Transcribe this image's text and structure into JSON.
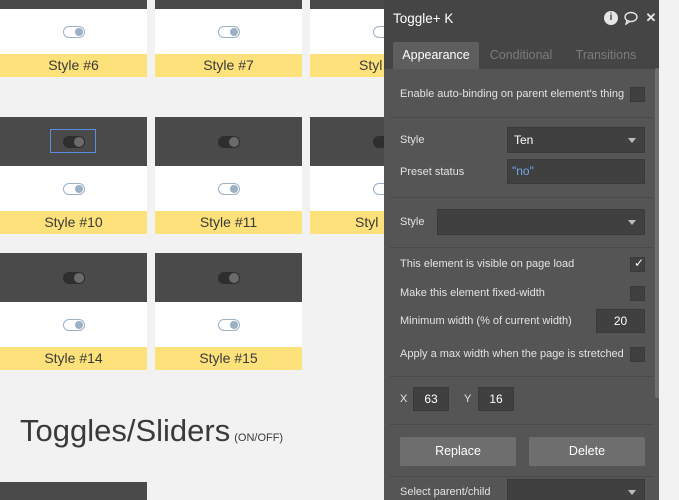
{
  "canvas": {
    "cards": [
      {
        "label": "Style #6"
      },
      {
        "label": "Style #7"
      },
      {
        "label": "Styl"
      },
      {
        "label": "Style #10"
      },
      {
        "label": "Style #11"
      },
      {
        "label": "Styl"
      },
      {
        "label": "Style #14"
      },
      {
        "label": "Style #15"
      }
    ],
    "section_title": "Toggles/Sliders",
    "section_subtitle": "(ON/OFF)"
  },
  "panel": {
    "title": "Toggle+ K",
    "tabs": [
      {
        "label": "Appearance",
        "active": true
      },
      {
        "label": "Conditional",
        "active": false
      },
      {
        "label": "Transitions",
        "active": false
      }
    ],
    "auto_binding_label": "Enable auto-binding on parent element's thing",
    "style_label": "Style",
    "style_value": "Ten",
    "preset_status_label": "Preset status",
    "preset_status_value": "\"no\"",
    "style2_label": "Style",
    "style2_value": "",
    "visible_label": "This element is visible on page load",
    "visible_checked": true,
    "fixed_width_label": "Make this element fixed-width",
    "fixed_width_checked": false,
    "min_width_label": "Minimum width (% of current width)",
    "min_width_value": "20",
    "max_width_label": "Apply a max width when the page is stretched",
    "max_width_checked": false,
    "x_label": "X",
    "x_value": "63",
    "y_label": "Y",
    "y_value": "16",
    "replace_label": "Replace",
    "delete_label": "Delete",
    "select_parent_label": "Select parent/child"
  },
  "colors": {
    "card_label_bg": "#fde17a",
    "card_dark": "#4a4a4a",
    "panel_bg": "#555555",
    "selection": "#5a8fe0",
    "preset_text": "#6fa8e8"
  }
}
